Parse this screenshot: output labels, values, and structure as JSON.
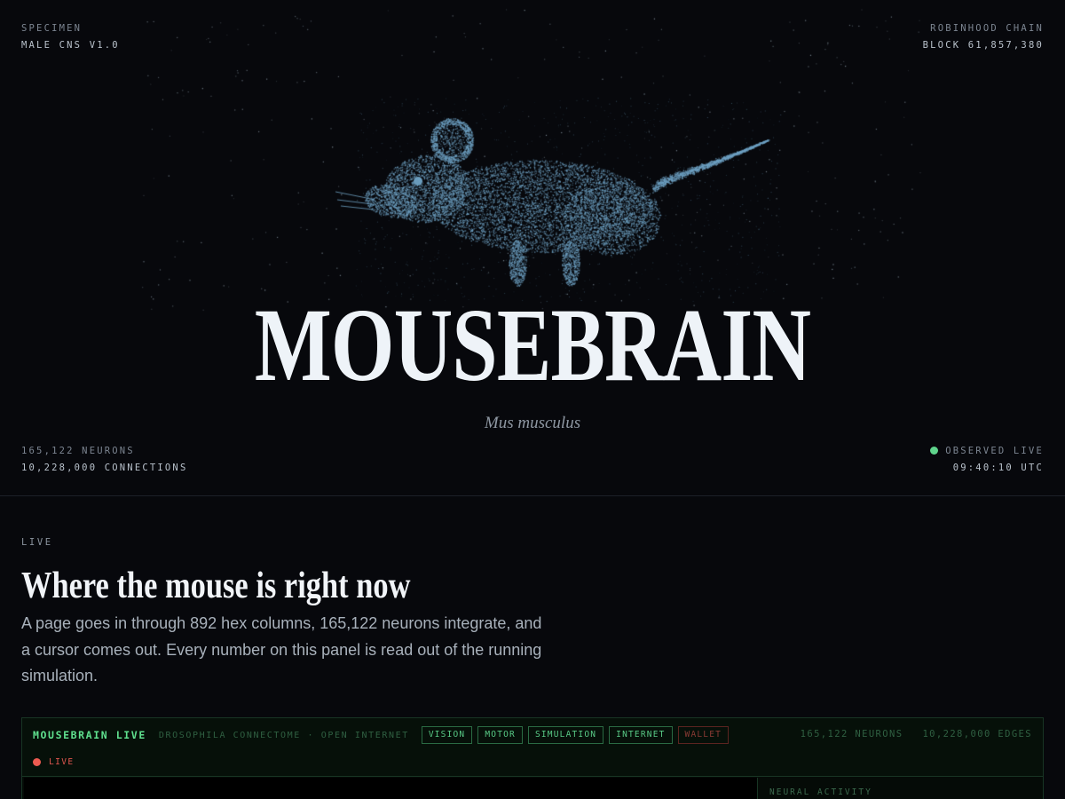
{
  "hero": {
    "top_left": {
      "label": "SPECIMEN",
      "value": "MALE CNS V1.0"
    },
    "top_right": {
      "label": "ROBINHOOD CHAIN",
      "value": "BLOCK 61,857,380"
    },
    "bottom_left": {
      "neurons": "165,122 NEURONS",
      "connections": "10,228,000 CONNECTIONS"
    },
    "bottom_right": {
      "status": "OBSERVED LIVE",
      "time": "09:40:10 UTC",
      "status_color": "#5fd48c"
    },
    "title": "MOUSEBRAIN",
    "subtitle": "Mus musculus",
    "particle_color": "#6fa2c4",
    "illustration": "mouse-particle-cloud"
  },
  "live_section": {
    "label": "LIVE",
    "heading": "Where the mouse is right now",
    "body": "A page goes in through 892 hex columns, 165,122 neurons integrate, and a cursor comes out. Every number on this panel is read out of the running simulation."
  },
  "panel": {
    "brand": "MOUSEBRAIN LIVE",
    "subtitle": "DROSOPHILA CONNECTOME · OPEN INTERNET",
    "tags": [
      {
        "label": "VISION",
        "state": "active"
      },
      {
        "label": "MOTOR",
        "state": "active"
      },
      {
        "label": "SIMULATION",
        "state": "active"
      },
      {
        "label": "INTERNET",
        "state": "active"
      },
      {
        "label": "WALLET",
        "state": "inactive"
      }
    ],
    "stats": {
      "neurons": "165,122 NEURONS",
      "edges": "10,228,000 EDGES"
    },
    "live_label": "LIVE",
    "activity_label": "NEURAL ACTIVITY",
    "colors": {
      "accent": "#5fe08e",
      "live": "#ec5a50",
      "border": "#183524"
    }
  }
}
